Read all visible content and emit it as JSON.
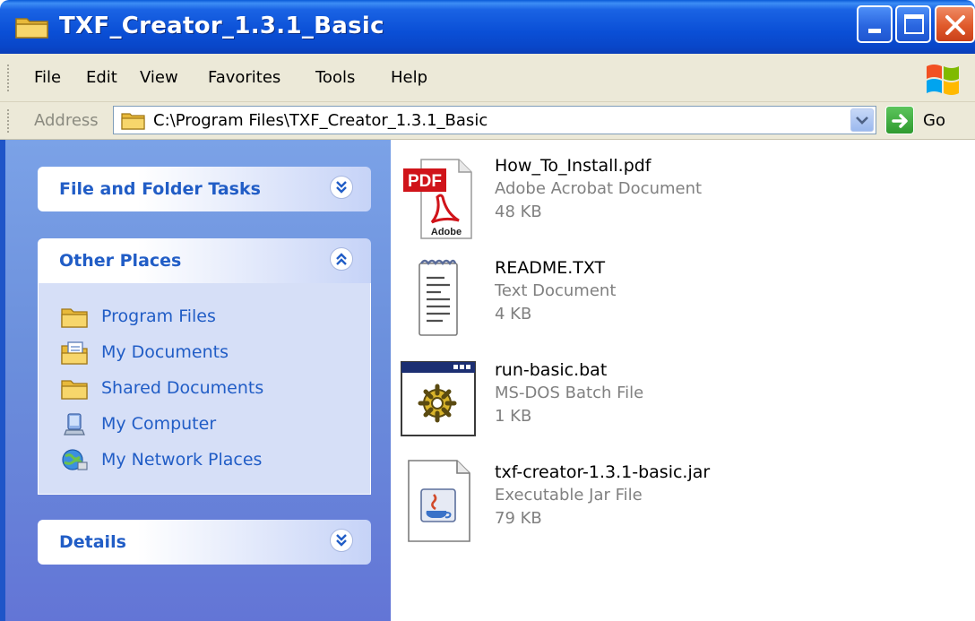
{
  "window": {
    "title": "TXF_Creator_1.3.1_Basic"
  },
  "menu": [
    "File",
    "Edit",
    "View",
    "Favorites",
    "Tools",
    "Help"
  ],
  "address": {
    "label": "Address",
    "path": "C:\\Program Files\\TXF_Creator_1.3.1_Basic",
    "go_label": "Go"
  },
  "taskpane": {
    "file_folder_tasks": {
      "title": "File and Folder Tasks",
      "expanded": false
    },
    "other_places": {
      "title": "Other Places",
      "expanded": true,
      "items": [
        {
          "label": "Program Files",
          "icon": "folder-icon"
        },
        {
          "label": "My Documents",
          "icon": "my-documents-icon"
        },
        {
          "label": "Shared Documents",
          "icon": "folder-icon"
        },
        {
          "label": "My Computer",
          "icon": "my-computer-icon"
        },
        {
          "label": "My Network Places",
          "icon": "network-places-icon"
        }
      ]
    },
    "details": {
      "title": "Details",
      "expanded": false
    }
  },
  "files": [
    {
      "name": "How_To_Install.pdf",
      "type": "Adobe Acrobat Document",
      "size": "48 KB",
      "icon": "pdf-file-icon",
      "icon_text": "PDF",
      "icon_subtext": "Adobe"
    },
    {
      "name": "README.TXT",
      "type": "Text Document",
      "size": "4 KB",
      "icon": "text-file-icon"
    },
    {
      "name": "run-basic.bat",
      "type": "MS-DOS Batch File",
      "size": "1 KB",
      "icon": "batch-file-icon"
    },
    {
      "name": "txf-creator-1.3.1-basic.jar",
      "type": "Executable Jar File",
      "size": "79 KB",
      "icon": "jar-file-icon"
    }
  ],
  "colors": {
    "titlebar": "#0a4fd6",
    "taskpane_link": "#215dc6",
    "close_button": "#e05a2b"
  }
}
